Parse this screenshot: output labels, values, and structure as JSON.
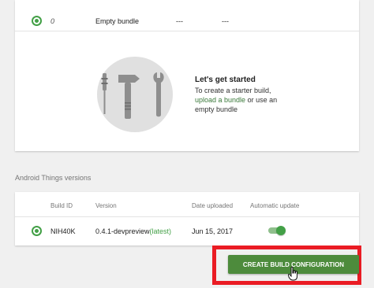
{
  "bundles": {
    "row": {
      "selected": true,
      "number": "0",
      "name": "Empty bundle",
      "col3": "---",
      "col4": "---"
    },
    "empty_state": {
      "title": "Let's get started",
      "line1": "To create a starter build,",
      "link_text": "upload a bundle",
      "after_link": " or use an",
      "line3": "empty bundle",
      "illustration_icons": [
        "screwdriver-icon",
        "hammer-icon",
        "wrench-icon"
      ]
    }
  },
  "versions": {
    "section_title": "Android Things versions",
    "columns": [
      "Build ID",
      "Version",
      "Date uploaded",
      "Automatic update"
    ],
    "rows": [
      {
        "selected": true,
        "build_id": "NIH40K",
        "version": "0.4.1-devpreview",
        "version_tag": "(latest)",
        "date_uploaded": "Jun 15, 2017",
        "automatic_update": true
      }
    ]
  },
  "actions": {
    "create_label": "CREATE BUILD CONFIGURATION"
  },
  "colors": {
    "accent_green": "#43a047",
    "button_green": "#4d8b3c",
    "highlight_red": "#ea1c24",
    "link_green": "#3b7a3b"
  }
}
